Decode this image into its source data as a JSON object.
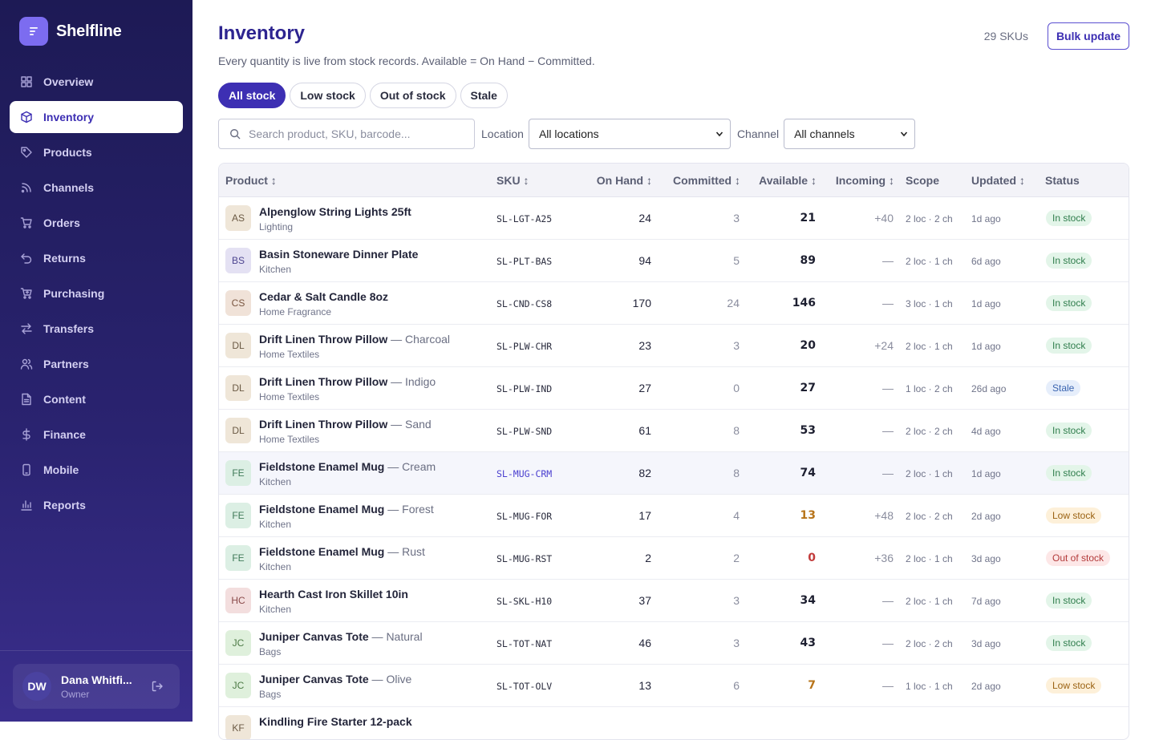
{
  "app": {
    "name": "Shelfline"
  },
  "nav": [
    {
      "label": "Overview",
      "icon": "grid-icon"
    },
    {
      "label": "Inventory",
      "icon": "box-icon",
      "active": true
    },
    {
      "label": "Products",
      "icon": "tag-icon"
    },
    {
      "label": "Channels",
      "icon": "rss-icon"
    },
    {
      "label": "Orders",
      "icon": "cart-icon"
    },
    {
      "label": "Returns",
      "icon": "undo-icon"
    },
    {
      "label": "Purchasing",
      "icon": "cart-plus-icon"
    },
    {
      "label": "Transfers",
      "icon": "arrows-icon"
    },
    {
      "label": "Partners",
      "icon": "users-icon"
    },
    {
      "label": "Content",
      "icon": "document-icon"
    },
    {
      "label": "Finance",
      "icon": "dollar-icon"
    },
    {
      "label": "Mobile",
      "icon": "phone-icon"
    },
    {
      "label": "Reports",
      "icon": "bar-chart-icon"
    }
  ],
  "user": {
    "initials": "DW",
    "name": "Dana Whitfi...",
    "role": "Owner"
  },
  "page": {
    "title": "Inventory",
    "subtitle": "Every quantity is live from stock records. Available = On Hand − Committed.",
    "sku_count": "29 SKUs",
    "bulk_update": "Bulk update"
  },
  "filters": {
    "chips": [
      {
        "label": "All stock",
        "active": true
      },
      {
        "label": "Low stock"
      },
      {
        "label": "Out of stock"
      },
      {
        "label": "Stale"
      }
    ],
    "search_placeholder": "Search product, SKU, barcode...",
    "location_label": "Location",
    "location_value": "All locations",
    "channel_label": "Channel",
    "channel_value": "All channels"
  },
  "table": {
    "headers": {
      "product": "Product ↕",
      "sku": "SKU ↕",
      "on_hand": "On Hand ↕",
      "committed": "Committed ↕",
      "available": "Available ↕",
      "incoming": "Incoming ↕",
      "scope": "Scope",
      "updated": "Updated ↕",
      "status": "Status"
    },
    "rows": [
      {
        "initials": "AS",
        "name": "Alpenglow String Lights 25ft",
        "variant": "",
        "category": "Lighting",
        "sku": "SL-LGT-A25",
        "on_hand": "24",
        "committed": "3",
        "available": "21",
        "incoming": "+40",
        "scope": "2 loc · 2 ch",
        "updated": "1d ago",
        "status": "In stock",
        "tone": "ok",
        "avatar_color": "#efe6d8",
        "avatar_text": "#6b5a44"
      },
      {
        "initials": "BS",
        "name": "Basin Stoneware Dinner Plate",
        "variant": "",
        "category": "Kitchen",
        "sku": "SL-PLT-BAS",
        "on_hand": "94",
        "committed": "5",
        "available": "89",
        "incoming": "—",
        "scope": "2 loc · 1 ch",
        "updated": "6d ago",
        "status": "In stock",
        "tone": "ok",
        "avatar_color": "#e4e1f3",
        "avatar_text": "#4d4590"
      },
      {
        "initials": "CS",
        "name": "Cedar & Salt Candle 8oz",
        "variant": "",
        "category": "Home Fragrance",
        "sku": "SL-CND-CS8",
        "on_hand": "170",
        "committed": "24",
        "available": "146",
        "incoming": "—",
        "scope": "3 loc · 1 ch",
        "updated": "1d ago",
        "status": "In stock",
        "tone": "ok",
        "avatar_color": "#f0e2d8",
        "avatar_text": "#7a5640"
      },
      {
        "initials": "DL",
        "name": "Drift Linen Throw Pillow",
        "variant": " — Charcoal",
        "category": "Home Textiles",
        "sku": "SL-PLW-CHR",
        "on_hand": "23",
        "committed": "3",
        "available": "20",
        "incoming": "+24",
        "scope": "2 loc · 1 ch",
        "updated": "1d ago",
        "status": "In stock",
        "tone": "ok",
        "avatar_color": "#efe6d8",
        "avatar_text": "#6b5a44"
      },
      {
        "initials": "DL",
        "name": "Drift Linen Throw Pillow",
        "variant": " — Indigo",
        "category": "Home Textiles",
        "sku": "SL-PLW-IND",
        "on_hand": "27",
        "committed": "0",
        "available": "27",
        "incoming": "—",
        "scope": "1 loc · 2 ch",
        "updated": "26d ago",
        "status": "Stale",
        "tone": "stale",
        "avatar_color": "#efe6d8",
        "avatar_text": "#6b5a44"
      },
      {
        "initials": "DL",
        "name": "Drift Linen Throw Pillow",
        "variant": " — Sand",
        "category": "Home Textiles",
        "sku": "SL-PLW-SND",
        "on_hand": "61",
        "committed": "8",
        "available": "53",
        "incoming": "—",
        "scope": "2 loc · 2 ch",
        "updated": "4d ago",
        "status": "In stock",
        "tone": "ok",
        "avatar_color": "#efe6d8",
        "avatar_text": "#6b5a44"
      },
      {
        "initials": "FE",
        "name": "Fieldstone Enamel Mug",
        "variant": " — Cream",
        "category": "Kitchen",
        "sku": "SL-MUG-CRM",
        "on_hand": "82",
        "committed": "8",
        "available": "74",
        "incoming": "—",
        "scope": "2 loc · 1 ch",
        "updated": "1d ago",
        "status": "In stock",
        "tone": "ok",
        "highlight": true,
        "avatar_color": "#dcefe4",
        "avatar_text": "#3f7a58"
      },
      {
        "initials": "FE",
        "name": "Fieldstone Enamel Mug",
        "variant": " — Forest",
        "category": "Kitchen",
        "sku": "SL-MUG-FOR",
        "on_hand": "17",
        "committed": "4",
        "available": "13",
        "incoming": "+48",
        "scope": "2 loc · 2 ch",
        "updated": "2d ago",
        "status": "Low stock",
        "tone": "low",
        "avatar_color": "#dcefe4",
        "avatar_text": "#3f7a58"
      },
      {
        "initials": "FE",
        "name": "Fieldstone Enamel Mug",
        "variant": " — Rust",
        "category": "Kitchen",
        "sku": "SL-MUG-RST",
        "on_hand": "2",
        "committed": "2",
        "available": "0",
        "incoming": "+36",
        "scope": "2 loc · 1 ch",
        "updated": "3d ago",
        "status": "Out of stock",
        "tone": "out",
        "avatar_color": "#dcefe4",
        "avatar_text": "#3f7a58"
      },
      {
        "initials": "HC",
        "name": "Hearth Cast Iron Skillet 10in",
        "variant": "",
        "category": "Kitchen",
        "sku": "SL-SKL-H10",
        "on_hand": "37",
        "committed": "3",
        "available": "34",
        "incoming": "—",
        "scope": "2 loc · 1 ch",
        "updated": "7d ago",
        "status": "In stock",
        "tone": "ok",
        "avatar_color": "#f3dede",
        "avatar_text": "#8a4a4a"
      },
      {
        "initials": "JC",
        "name": "Juniper Canvas Tote",
        "variant": " — Natural",
        "category": "Bags",
        "sku": "SL-TOT-NAT",
        "on_hand": "46",
        "committed": "3",
        "available": "43",
        "incoming": "—",
        "scope": "2 loc · 2 ch",
        "updated": "3d ago",
        "status": "In stock",
        "tone": "ok",
        "avatar_color": "#dff0dc",
        "avatar_text": "#4c7a45"
      },
      {
        "initials": "JC",
        "name": "Juniper Canvas Tote",
        "variant": " — Olive",
        "category": "Bags",
        "sku": "SL-TOT-OLV",
        "on_hand": "13",
        "committed": "6",
        "available": "7",
        "incoming": "—",
        "scope": "1 loc · 1 ch",
        "updated": "2d ago",
        "status": "Low stock",
        "tone": "low",
        "avatar_color": "#dff0dc",
        "avatar_text": "#4c7a45"
      },
      {
        "initials": "KF",
        "name": "Kindling Fire Starter 12-pack",
        "variant": "",
        "category": "",
        "sku": "",
        "on_hand": "",
        "committed": "",
        "available": "",
        "incoming": "",
        "scope": "",
        "updated": "",
        "status": "",
        "tone": "",
        "avatar_color": "#efe6d8",
        "avatar_text": "#6b5a44"
      }
    ]
  },
  "colors": {
    "accent": "#3d2fb3",
    "ok_bg": "#e3f5e9",
    "ok_fg": "#2f7d4c",
    "stale_bg": "#e6eefb",
    "stale_fg": "#3a64b0",
    "low_bg": "#fdf0d9",
    "low_fg": "#9a6212",
    "out_bg": "#fde7e7",
    "out_fg": "#b33a3a",
    "low_num": "#b7741a",
    "out_num": "#c23b3b"
  }
}
